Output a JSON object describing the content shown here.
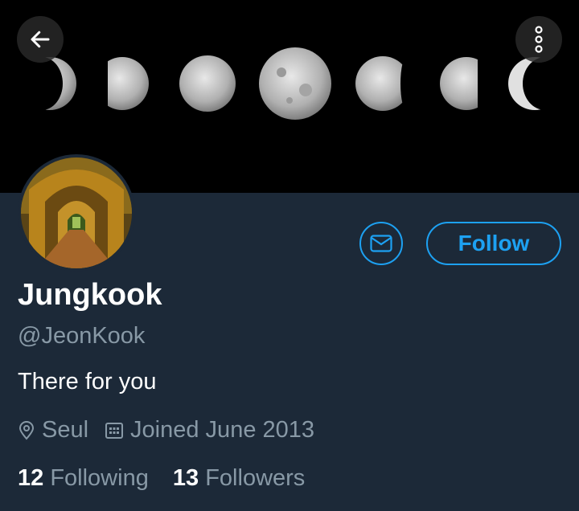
{
  "header": {
    "back_icon": "arrow-left-icon",
    "menu_icon": "more-vertical-icon"
  },
  "profile": {
    "name": "Jungkook",
    "handle": "@JeonKook",
    "bio": "There for you",
    "location": "Seul",
    "joined": "Joined June 2013",
    "following_count": "12",
    "following_label": "Following",
    "followers_count": "13",
    "followers_label": "Followers"
  },
  "actions": {
    "follow_label": "Follow",
    "message_icon": "mail-icon"
  },
  "colors": {
    "accent": "#1da1f2",
    "background": "#1c2938",
    "secondary_text": "#8899a6"
  }
}
